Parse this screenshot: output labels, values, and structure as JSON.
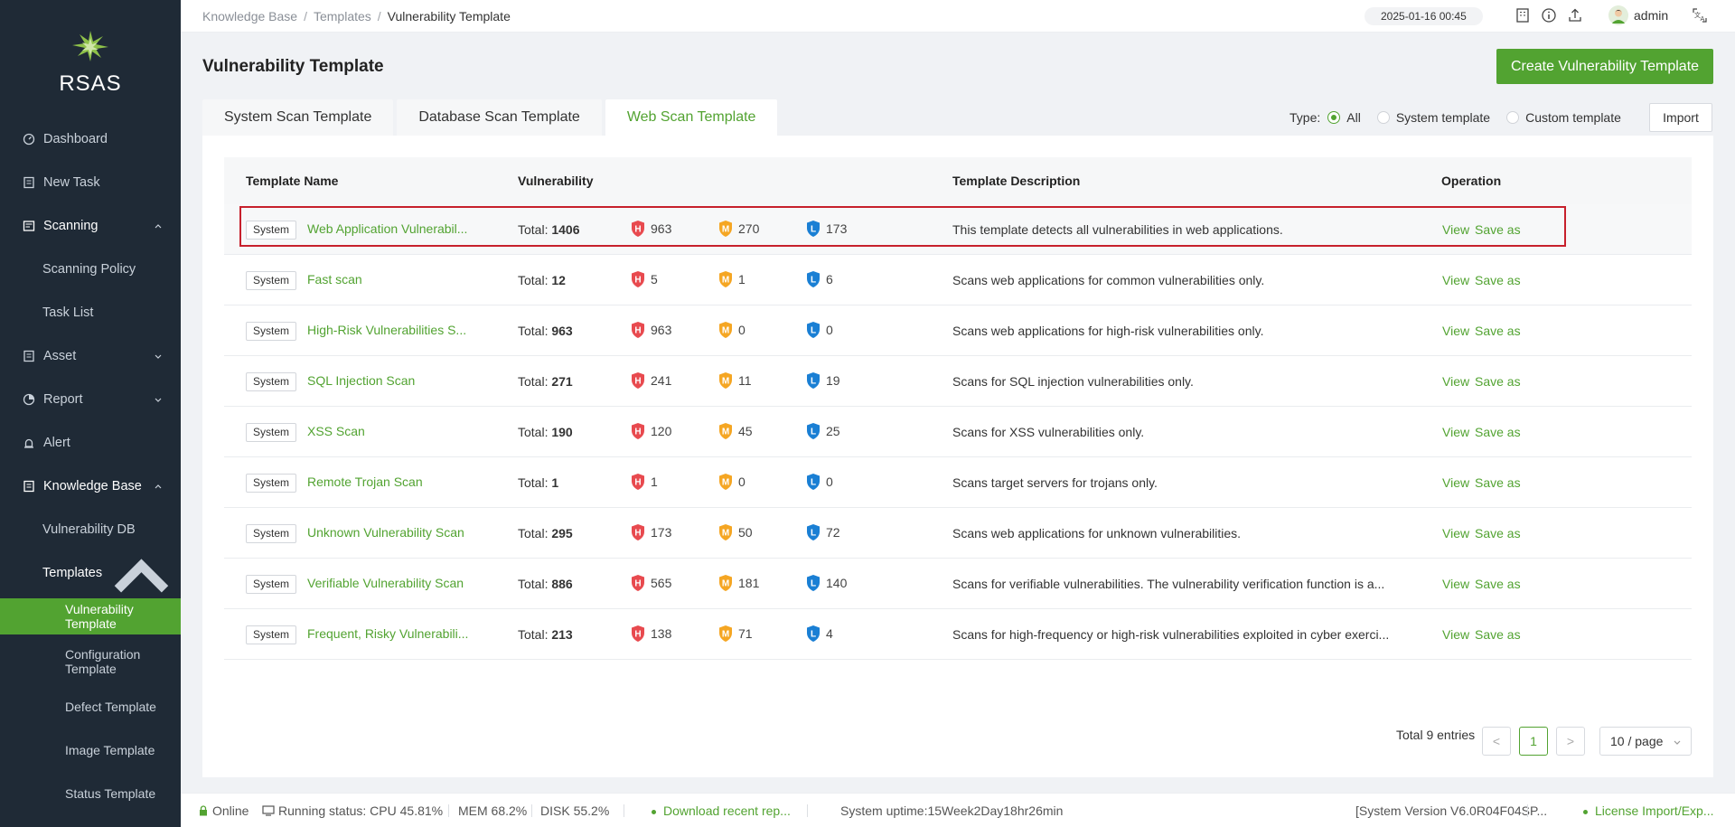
{
  "brand": {
    "name": "RSAS"
  },
  "sidebar": {
    "items": [
      {
        "label": "Dashboard"
      },
      {
        "label": "New Task"
      },
      {
        "label": "Scanning"
      },
      {
        "label": "Scanning Policy"
      },
      {
        "label": "Task List"
      },
      {
        "label": "Asset"
      },
      {
        "label": "Report"
      },
      {
        "label": "Alert"
      },
      {
        "label": "Knowledge Base"
      },
      {
        "label": "Vulnerability DB"
      },
      {
        "label": "Templates"
      },
      {
        "label": "Vulnerability Template"
      },
      {
        "label": "Configuration Template"
      },
      {
        "label": "Defect Template"
      },
      {
        "label": "Image Template"
      },
      {
        "label": "Status Template"
      }
    ]
  },
  "header": {
    "breadcrumb": [
      "Knowledge Base",
      "Templates",
      "Vulnerability Template"
    ],
    "breadcrumb_sep": "/",
    "datetime": "2025-01-16 00:45",
    "user": "admin"
  },
  "page": {
    "title": "Vulnerability Template",
    "create_label": "Create Vulnerability Template",
    "tabs": [
      "System Scan Template",
      "Database Scan Template",
      "Web Scan Template"
    ],
    "active_tab": "Web Scan Template",
    "type_label": "Type:",
    "type_options": [
      "All",
      "System template",
      "Custom template"
    ],
    "type_selected": "All",
    "import_label": "Import"
  },
  "table": {
    "columns": [
      "Template Name",
      "Vulnerability",
      "Template Description",
      "Operation"
    ],
    "total_prefix": "Total:",
    "level_letters": {
      "high": "H",
      "medium": "M",
      "low": "L"
    },
    "ops": [
      "View",
      "Save as"
    ],
    "rows": [
      {
        "type": "System",
        "name": "Web Application Vulnerabil...",
        "total": "1406",
        "high": "963",
        "medium": "270",
        "low": "173",
        "desc": "This template detects all vulnerabilities in web applications."
      },
      {
        "type": "System",
        "name": "Fast scan",
        "total": "12",
        "high": "5",
        "medium": "1",
        "low": "6",
        "desc": "Scans web applications for common vulnerabilities only."
      },
      {
        "type": "System",
        "name": "High-Risk Vulnerabilities S...",
        "total": "963",
        "high": "963",
        "medium": "0",
        "low": "0",
        "desc": "Scans web applications for high-risk vulnerabilities only."
      },
      {
        "type": "System",
        "name": "SQL Injection Scan",
        "total": "271",
        "high": "241",
        "medium": "11",
        "low": "19",
        "desc": "Scans for SQL injection vulnerabilities only."
      },
      {
        "type": "System",
        "name": "XSS Scan",
        "total": "190",
        "high": "120",
        "medium": "45",
        "low": "25",
        "desc": "Scans for XSS vulnerabilities only."
      },
      {
        "type": "System",
        "name": "Remote Trojan Scan",
        "total": "1",
        "high": "1",
        "medium": "0",
        "low": "0",
        "desc": "Scans target servers for trojans only."
      },
      {
        "type": "System",
        "name": "Unknown Vulnerability Scan",
        "total": "295",
        "high": "173",
        "medium": "50",
        "low": "72",
        "desc": "Scans web applications for unknown vulnerabilities."
      },
      {
        "type": "System",
        "name": "Verifiable Vulnerability Scan",
        "total": "886",
        "high": "565",
        "medium": "181",
        "low": "140",
        "desc": "Scans for verifiable vulnerabilities. The vulnerability verification function is a..."
      },
      {
        "type": "System",
        "name": "Frequent, Risky Vulnerabili...",
        "total": "213",
        "high": "138",
        "medium": "71",
        "low": "4",
        "desc": "Scans for high-frequency or high-risk vulnerabilities exploited in cyber exerci..."
      }
    ]
  },
  "pagination": {
    "total_text": "Total 9 entries",
    "prev": "<",
    "current": "1",
    "next": ">",
    "page_size": "10 / page"
  },
  "footer": {
    "online": "Online",
    "running": "Running status: CPU 45.81%",
    "mem": "MEM 68.2%",
    "disk": "DISK 55.2%",
    "download": "Download recent rep...",
    "uptime": "System uptime:15Week2Day18hr26min",
    "version": "[System Version V6.0R04F04SP...",
    "license": "License Import/Exp..."
  },
  "colors": {
    "accent": "#52a331",
    "sidebar_bg": "#1f2a36",
    "high": "#e84a4f",
    "medium": "#f5a623",
    "low": "#1a7fd4",
    "highlight_box": "#c7202c"
  }
}
